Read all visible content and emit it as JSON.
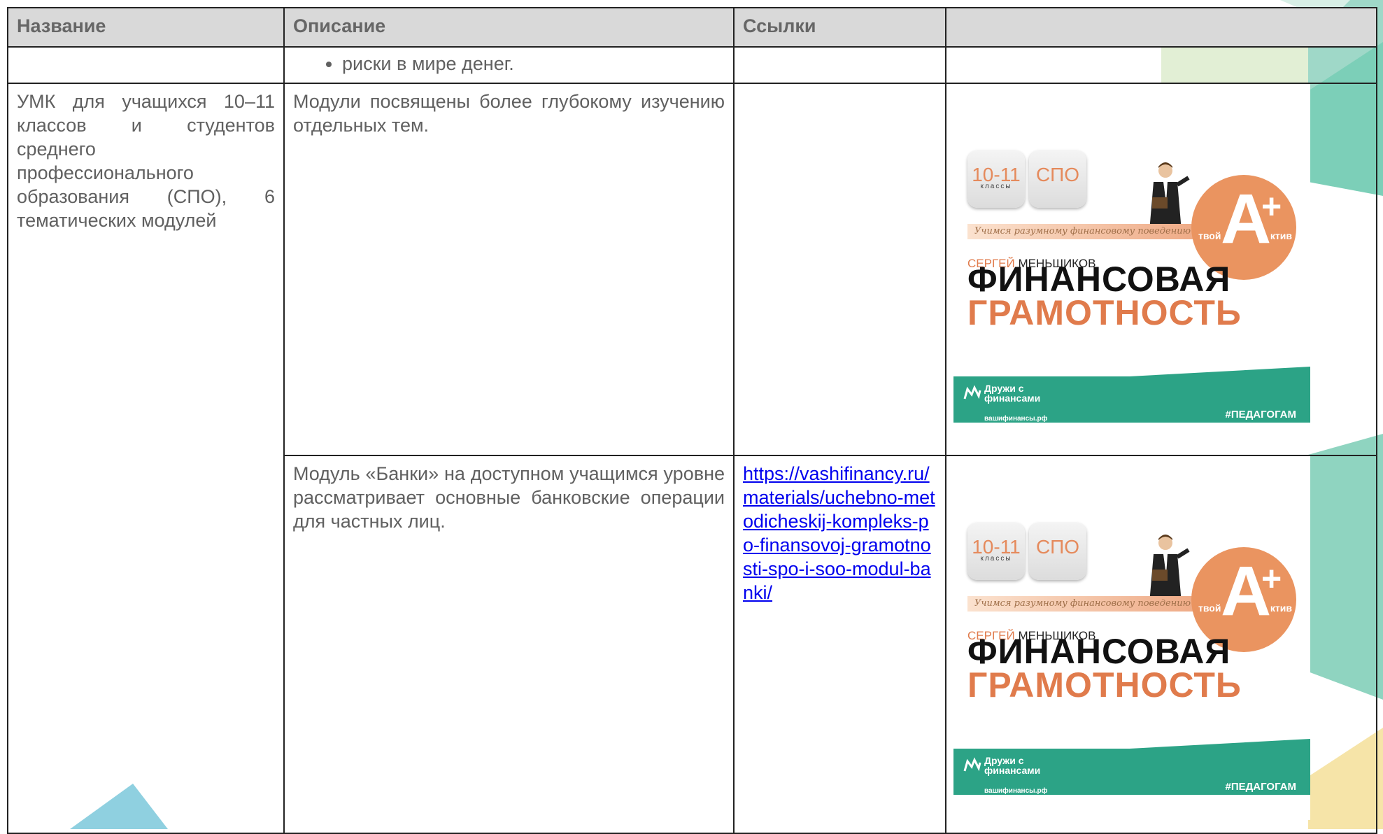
{
  "headers": {
    "name": "Название",
    "description": "Описание",
    "links": "Ссылки",
    "image": ""
  },
  "row_prev": {
    "bullet": "риски в мире денег."
  },
  "row_umk": {
    "name": "УМК для учащихся 10–11 классов и студентов среднего профессионального образования (СПО), 6 тематических модулей",
    "description": "Модули посвящены более глубокому изучению отдельных тем."
  },
  "row_banki": {
    "description": "Модуль «Банки» на доступном учащимся уровне рассматривает основные банковские операции для частных лиц.",
    "link": "https://vashifinancy.ru/materials/uchebno-metodicheskij-kompleks-po-finansovoj-gramotnosti-spo-i-soo-modul-banki/"
  },
  "cover": {
    "badge_grade": "10-11",
    "badge_grade_sub": "классы",
    "badge_spo": "СПО",
    "slogan": "Учимся разумному финансовому поведению",
    "circle_left": "твой",
    "circle_big": "А",
    "circle_plus": "+",
    "circle_right": "ктив",
    "author_first": "СЕРГЕЙ",
    "author_last": "МЕНЬШИКОВ",
    "title_line1": "ФИНАНСОВАЯ",
    "title_line2": "ГРАМОТНОСТЬ",
    "brand": "Дружи с финансами",
    "site": "вашифинансы.рф",
    "hashtag": "#ПЕДАГОГАМ"
  },
  "colors": {
    "header_bg": "#d9d9d9",
    "link": "#0000ee",
    "accent_orange": "#ea9460",
    "accent_green": "#2ca386"
  }
}
